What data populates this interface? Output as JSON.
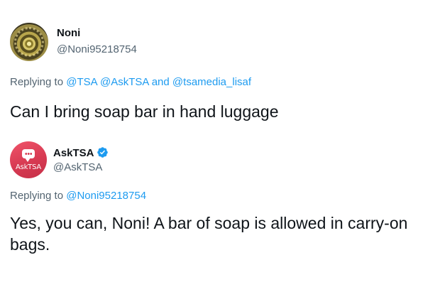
{
  "first_tweet": {
    "display_name": "Noni",
    "handle": "@Noni95218754",
    "replying_prefix": "Replying to ",
    "mentions": [
      "@TSA",
      "@AskTSA",
      "@tsamedia_lisaf"
    ],
    "mention_separator": " ",
    "mention_and": " and ",
    "text": "Can I bring soap bar in hand luggage"
  },
  "second_tweet": {
    "display_name": "AskTSA",
    "handle": "@AskTSA",
    "avatar_text": "AskTSA",
    "verified_icon": "verified-badge-icon",
    "replying_prefix": "Replying to ",
    "mentions": [
      "@Noni95218754"
    ],
    "text_line1": "Yes, you can, Noni! A bar of soap is allowed in carry-on",
    "text_line2": "bags."
  },
  "colors": {
    "mention": "#1d9bf0",
    "secondary_text": "#536471",
    "primary_text": "#0f1419",
    "verified": "#1d9bf0",
    "asktsa_avatar": "#d73a52"
  }
}
